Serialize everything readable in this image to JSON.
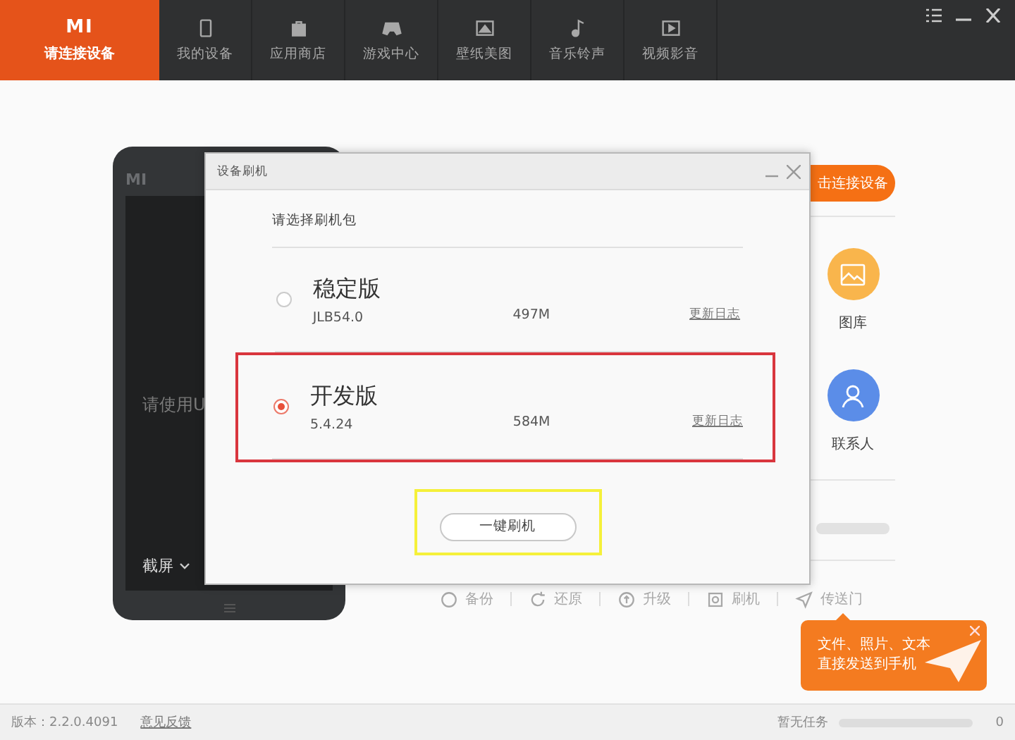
{
  "header": {
    "logo": "MI",
    "device_label": "请连接设备"
  },
  "nav": [
    {
      "label": "我的设备",
      "kind": "phone",
      "selected": false
    },
    {
      "label": "应用商店",
      "kind": "bag",
      "selected": false
    },
    {
      "label": "游戏中心",
      "kind": "gamepad",
      "selected": false
    },
    {
      "label": "壁纸美图",
      "kind": "wallpaper",
      "selected": false
    },
    {
      "label": "音乐铃声",
      "kind": "music",
      "selected": false
    },
    {
      "label": "视频影音",
      "kind": "video",
      "selected": false
    }
  ],
  "phone": {
    "logo": "MI",
    "hint": "请使用U",
    "screenshot": "截屏"
  },
  "connect_button": "击连接设备",
  "features": [
    {
      "label": "图库",
      "kind": "gallery",
      "color": "#f9b54c"
    },
    {
      "label": "联系人",
      "kind": "contacts",
      "color": "#5b8de8"
    }
  ],
  "toolbar": [
    {
      "label": "备份",
      "kind": "backup"
    },
    {
      "label": "还原",
      "kind": "restore"
    },
    {
      "label": "升级",
      "kind": "upgrade"
    },
    {
      "label": "刷机",
      "kind": "flash"
    },
    {
      "label": "传送门",
      "kind": "transfer"
    }
  ],
  "tooltip": {
    "lines": [
      "文件、照片、文本",
      "直接发送到手机"
    ]
  },
  "dialog": {
    "title": "设备刷机",
    "prompt": "请选择刷机包",
    "options": [
      {
        "name": "稳定版",
        "version": "JLB54.0",
        "size": "497M",
        "link": "更新日志",
        "selected": false,
        "highlighted": false
      },
      {
        "name": "开发版",
        "version": "5.4.24",
        "size": "584M",
        "link": "更新日志",
        "selected": true,
        "highlighted": true
      }
    ],
    "button": "一键刷机",
    "button_highlighted": true
  },
  "status_bar": {
    "version": "版本：2.2.0.4091",
    "feedback": "意见反馈",
    "task": "暂无任务",
    "count": "0"
  }
}
